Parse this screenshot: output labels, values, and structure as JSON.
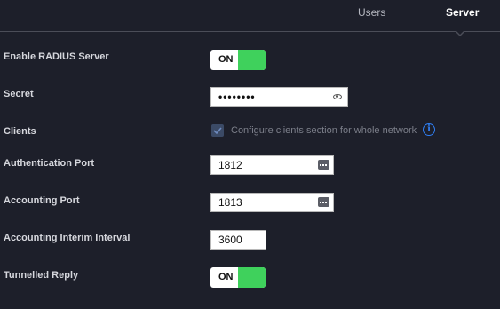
{
  "tabs": {
    "users": "Users",
    "server": "Server"
  },
  "enable_radius": {
    "label": "Enable RADIUS Server",
    "state": "ON"
  },
  "secret": {
    "label": "Secret",
    "masked_value": "••••••••"
  },
  "clients": {
    "label": "Clients",
    "checkbox_label": "Configure clients section for whole network",
    "checked": true
  },
  "auth_port": {
    "label": "Authentication Port",
    "value": "1812"
  },
  "acct_port": {
    "label": "Accounting Port",
    "value": "1813"
  },
  "acct_interim": {
    "label": "Accounting Interim Interval",
    "value": "3600"
  },
  "tunnelled_reply": {
    "label": "Tunnelled Reply",
    "state": "ON"
  },
  "colors": {
    "background": "#1d1f2a",
    "toggle_on": "#3fd15c",
    "info": "#2f7ff5"
  },
  "icons": {
    "secret_reveal": "eye-icon",
    "port_stepper": "stepper-icon",
    "clients_info": "info-icon"
  }
}
